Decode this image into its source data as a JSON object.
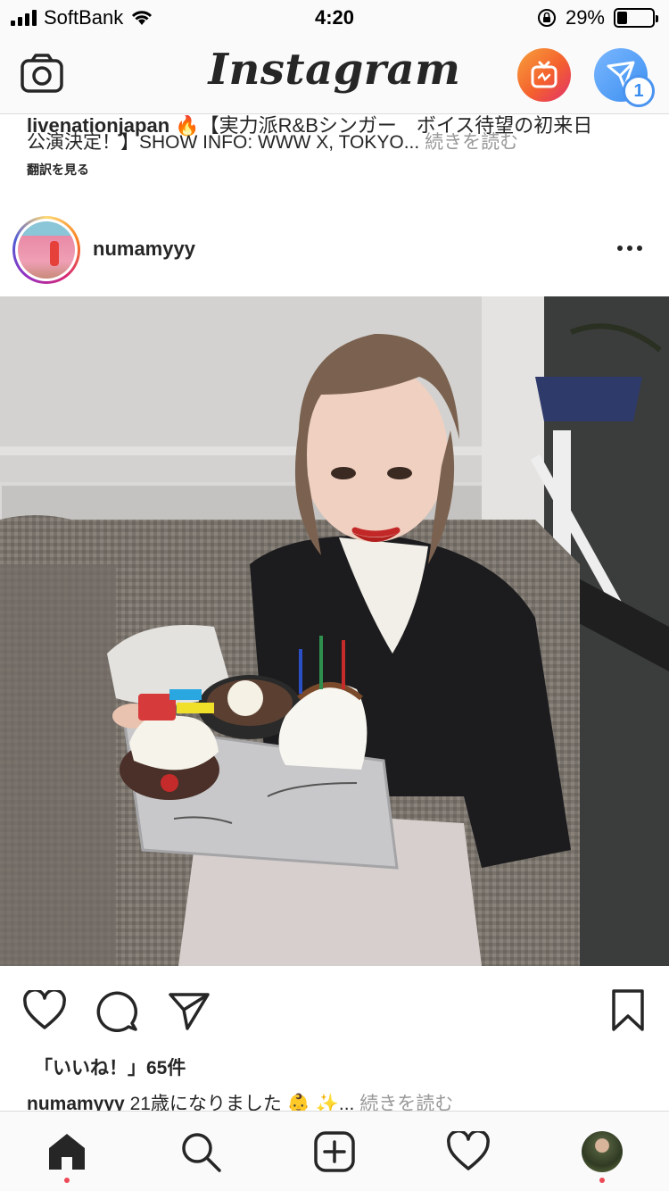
{
  "status_bar": {
    "carrier": "SoftBank",
    "time": "4:20",
    "battery": "29%",
    "battery_level": 0.29
  },
  "header": {
    "logo": "Instagram",
    "dm_badge_count": "1",
    "icons": {
      "camera": "camera-icon",
      "igtv": "igtv-icon",
      "direct": "paper-plane-icon"
    }
  },
  "previous_post": {
    "caption_user": "livenationjapan",
    "caption_line1": "🔥【実力派R&Bシンガー　ボイス待望の初来日",
    "caption_line2": "公演決定！】SHOW INFO: WWW X, TOKYO...",
    "more_label": "続きを読む",
    "translate_label": "翻訳を見る"
  },
  "post": {
    "username": "numamyyy",
    "more_icon": "more-dots-icon",
    "photo_alt": "",
    "likes_label": "「いいね！」65件",
    "caption_user": "numamyyy",
    "caption_text": "21歳になりました 👶 ✨...",
    "caption_more": "続きを読む",
    "actions": {
      "like": "heart-icon",
      "comment": "comment-icon",
      "share": "paper-plane-icon",
      "save": "bookmark-icon"
    }
  },
  "tab_bar": {
    "items": [
      {
        "name": "home",
        "icon": "home-icon",
        "active": true,
        "dot": true
      },
      {
        "name": "search",
        "icon": "search-icon",
        "active": false,
        "dot": false
      },
      {
        "name": "new-post",
        "icon": "plus-square-icon",
        "active": false,
        "dot": false
      },
      {
        "name": "activity",
        "icon": "heart-icon",
        "active": false,
        "dot": false
      },
      {
        "name": "profile",
        "icon": "profile-avatar",
        "active": false,
        "dot": true
      }
    ]
  },
  "colors": {
    "notification_dot": "#ed4956",
    "link_gray": "#999999",
    "text": "#262626",
    "dm_blue": "#3b8ef0",
    "igtv_orange": "#f4602e"
  }
}
